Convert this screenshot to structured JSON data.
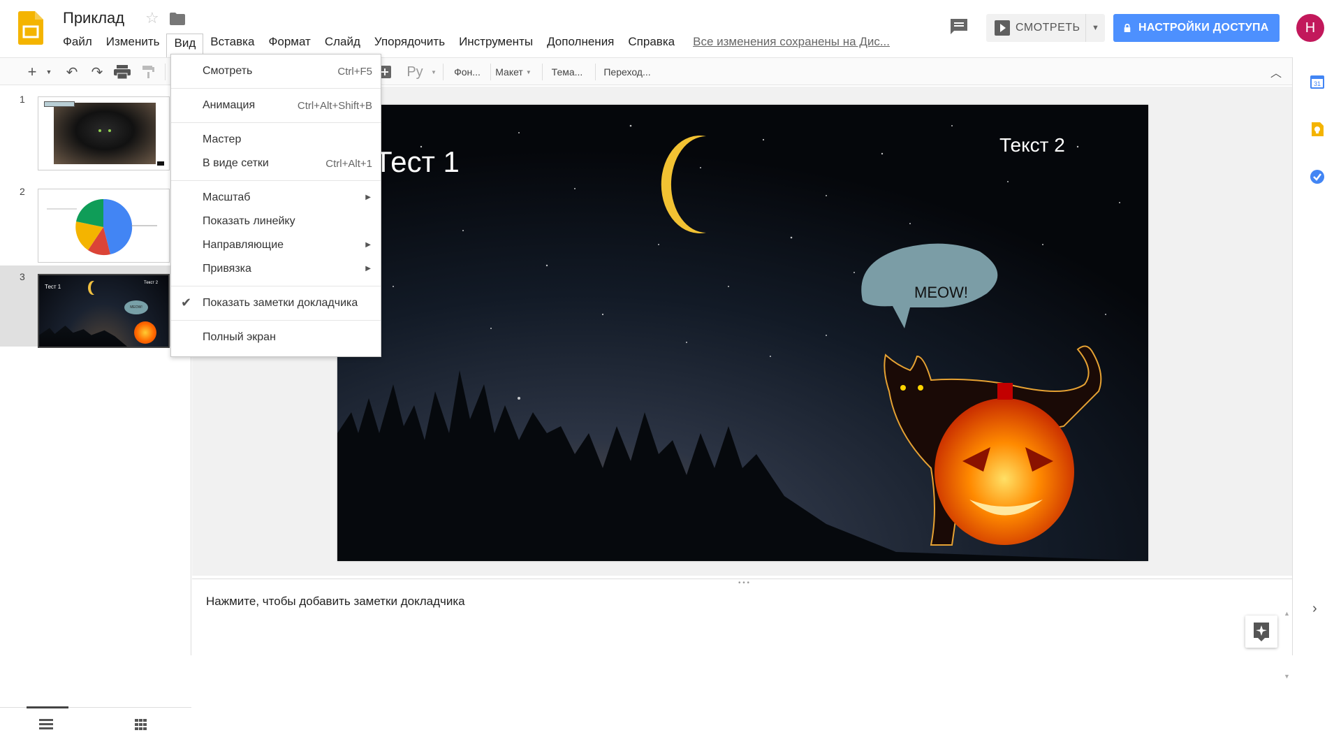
{
  "app": {
    "title": "Приклад",
    "save_status": "Все изменения сохранены на Дис...",
    "avatar_letter": "Н",
    "accent_color": "#4d90fe",
    "avatar_color": "#c2185b"
  },
  "menubar": {
    "items": [
      "Файл",
      "Изменить",
      "Вид",
      "Вставка",
      "Формат",
      "Слайд",
      "Упорядочить",
      "Инструменты",
      "Дополнения",
      "Справка"
    ],
    "active": "Вид"
  },
  "header_buttons": {
    "present_label": "СМОТРЕТЬ",
    "share_label": "НАСТРОЙКИ ДОСТУПА"
  },
  "toolbar": {
    "font_label": "Ру",
    "background_label": "Фон...",
    "layout_label": "Макет",
    "theme_label": "Тема...",
    "transition_label": "Переход..."
  },
  "view_menu": {
    "items": [
      {
        "label": "Смотреть",
        "shortcut": "Ctrl+F5"
      },
      {
        "label": "Анимация",
        "shortcut": "Ctrl+Alt+Shift+B"
      },
      {
        "label": "Мастер",
        "shortcut": ""
      },
      {
        "label": "В виде сетки",
        "shortcut": "Ctrl+Alt+1"
      },
      {
        "label": "Масштаб",
        "submenu": true
      },
      {
        "label": "Показать линейку",
        "shortcut": ""
      },
      {
        "label": "Направляющие",
        "submenu": true
      },
      {
        "label": "Привязка",
        "submenu": true
      },
      {
        "label": "Показать заметки докладчика",
        "checked": true
      },
      {
        "label": "Полный экран",
        "shortcut": ""
      }
    ]
  },
  "filmstrip": {
    "slides": [
      {
        "number": "1"
      },
      {
        "number": "2"
      },
      {
        "number": "3",
        "selected": true,
        "thumb_title": "Тест 1",
        "thumb_text2": "Текст 2",
        "thumb_bubble": "MEOW!"
      }
    ]
  },
  "slide": {
    "title": "Тест 1",
    "text2": "Текст 2",
    "bubble_text": "MEOW!"
  },
  "notes": {
    "placeholder": "Нажмите, чтобы добавить заметки докладчика"
  }
}
